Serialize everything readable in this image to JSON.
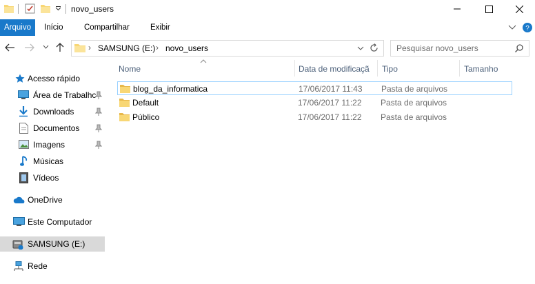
{
  "window": {
    "title": "novo_users",
    "qat_dropdown_icon": "chevron-down-icon"
  },
  "ribbon": {
    "tabs": [
      {
        "label": "Arquivo",
        "active": true
      },
      {
        "label": "Início"
      },
      {
        "label": "Compartilhar"
      },
      {
        "label": "Exibir"
      }
    ]
  },
  "address": {
    "crumbs": [
      "SAMSUNG (E:)",
      "novo_users"
    ]
  },
  "search": {
    "placeholder": "Pesquisar novo_users"
  },
  "sidebar": {
    "quick_access": "Acesso rápido",
    "items": [
      {
        "label": "Área de Trabalhc",
        "icon": "desktop-icon",
        "pinned": true
      },
      {
        "label": "Downloads",
        "icon": "download-icon",
        "pinned": true
      },
      {
        "label": "Documentos",
        "icon": "documents-icon",
        "pinned": true
      },
      {
        "label": "Imagens",
        "icon": "pictures-icon",
        "pinned": true
      },
      {
        "label": "Músicas",
        "icon": "music-icon"
      },
      {
        "label": "Vídeos",
        "icon": "videos-icon"
      }
    ],
    "onedrive": "OneDrive",
    "this_pc": "Este Computador",
    "drive": "SAMSUNG (E:)",
    "network": "Rede"
  },
  "columns": {
    "name": "Nome",
    "date": "Data de modificaçã",
    "type": "Tipo",
    "size": "Tamanho"
  },
  "files": [
    {
      "name": "blog_da_informatica",
      "date": "17/06/2017 11:43",
      "type": "Pasta de arquivos"
    },
    {
      "name": "Default",
      "date": "17/06/2017 11:22",
      "type": "Pasta de arquivos"
    },
    {
      "name": "Público",
      "date": "17/06/2017 11:22",
      "type": "Pasta de arquivos"
    }
  ],
  "colors": {
    "accent": "#1979ca",
    "folder": "#f8d775",
    "selection_border": "#99d1ff",
    "drive_selected": "#d9d9d9"
  }
}
